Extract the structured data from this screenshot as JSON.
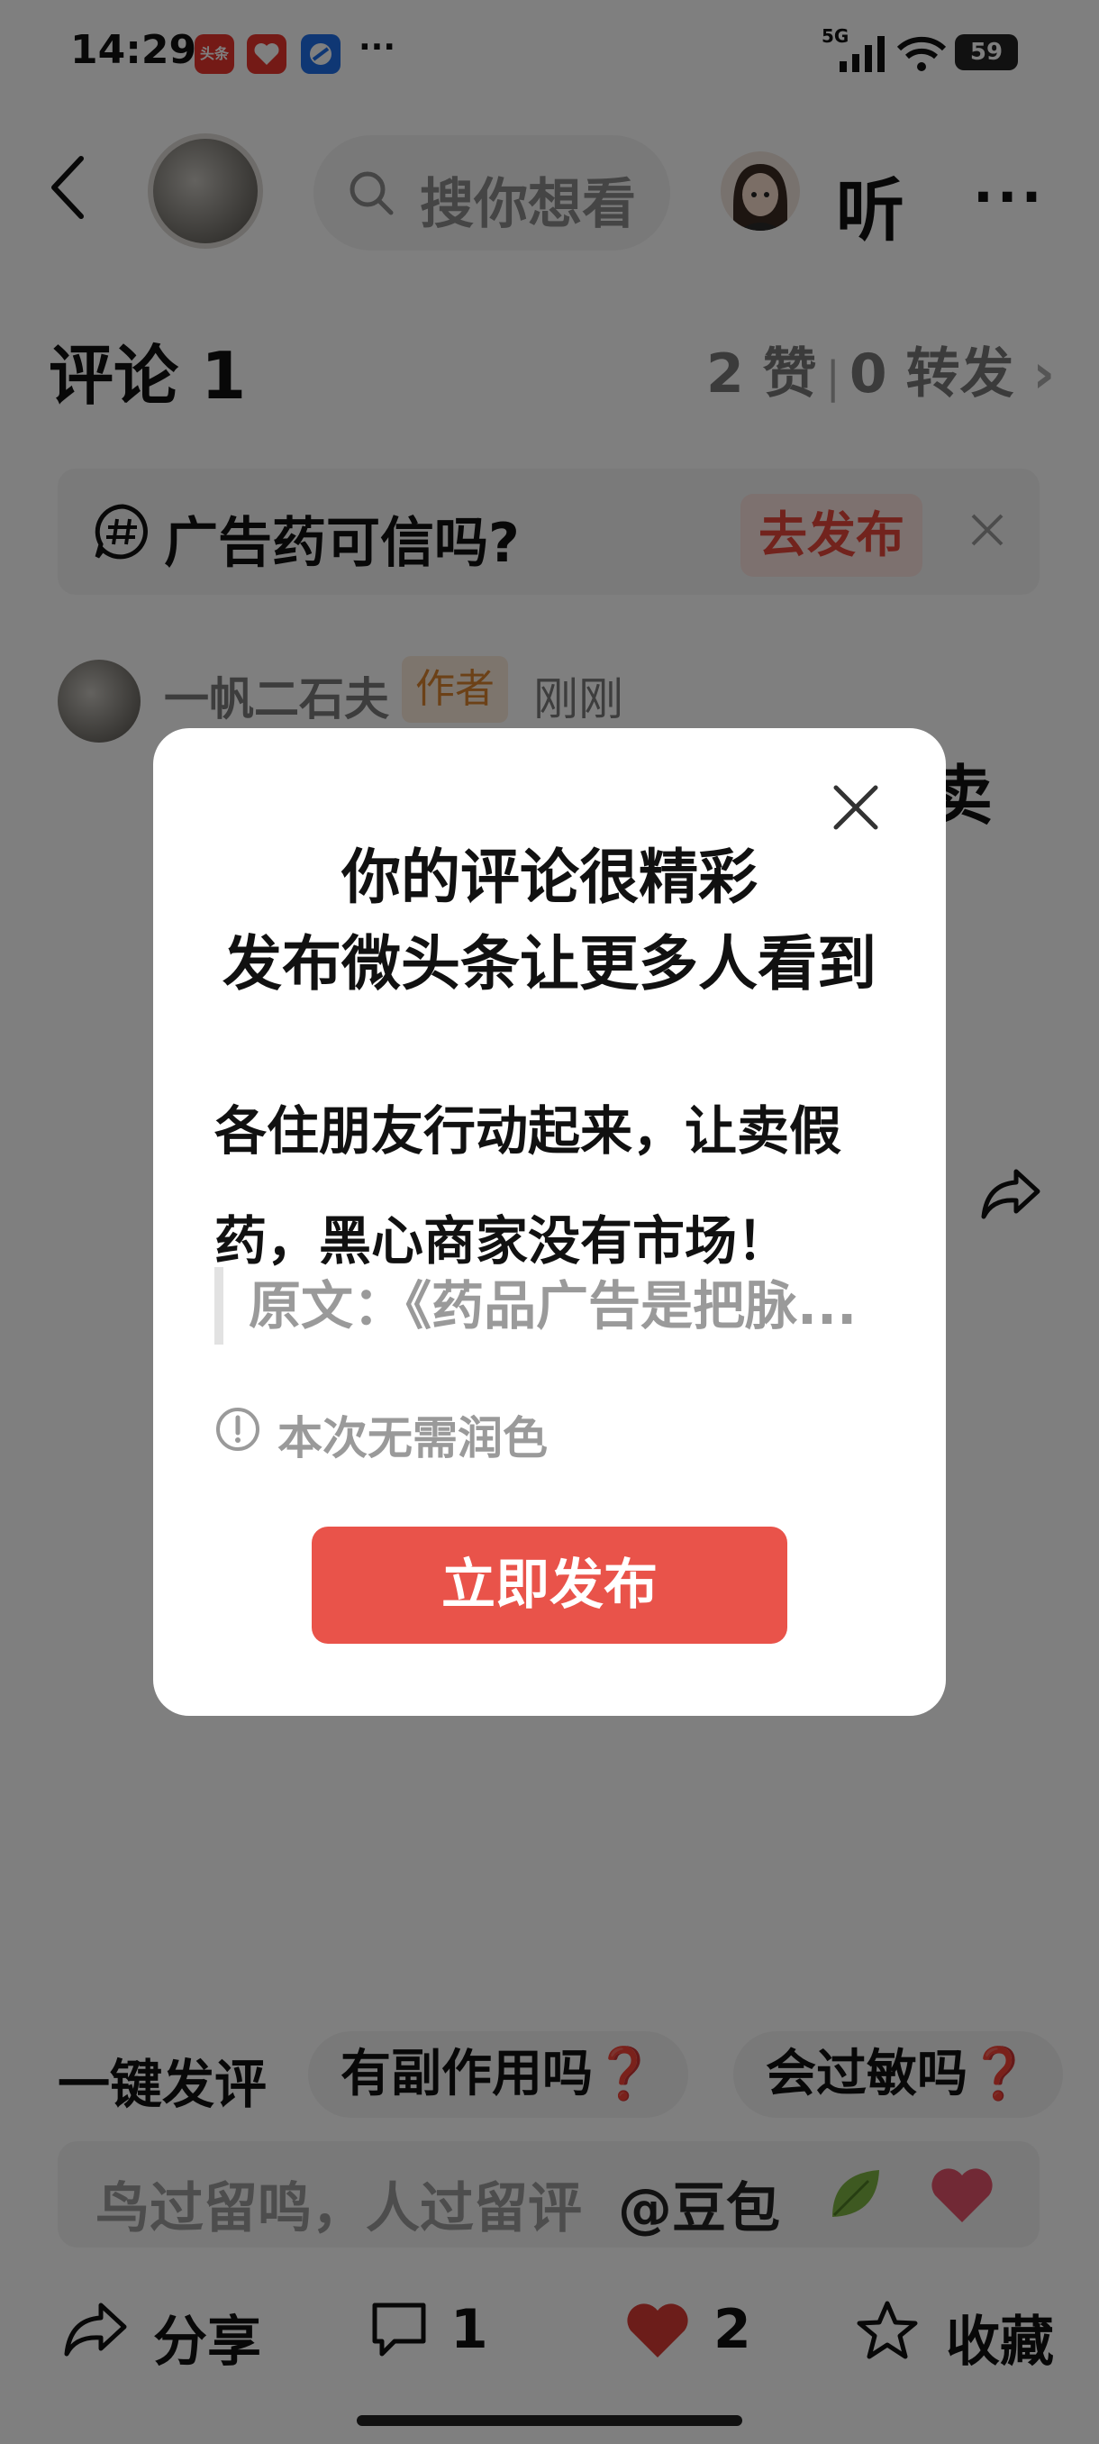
{
  "status_bar": {
    "time": "14:29",
    "toutiao_icon_text": "头条",
    "more": "···",
    "network": "5G",
    "battery": "59"
  },
  "header": {
    "search_placeholder": "搜你想看",
    "listen_label": "听",
    "more_label": "···"
  },
  "comments": {
    "title": "评论 1",
    "likes": "2 赞",
    "reposts": "0 转发",
    "stats_arrow": "›"
  },
  "topic": {
    "text": "广告药可信吗?",
    "publish_label": "去发布"
  },
  "comment": {
    "username": "一帆二石夫",
    "badge": "作者",
    "time": "刚刚",
    "visible_tail": "卖"
  },
  "quick_reply": {
    "label": "一键发评",
    "chip1": "有副作用吗",
    "chip1_mark": "❓",
    "chip2": "会过敏吗",
    "chip2_mark": "❓"
  },
  "input": {
    "placeholder": "鸟过留鸣，人过留评",
    "doubao": "@豆包"
  },
  "actions": {
    "share_label": "分享",
    "comment_count": "1",
    "like_count": "2",
    "favorite_label": "收藏"
  },
  "dialog": {
    "title_line1": "你的评论很精彩",
    "title_line2": "发布微头条让更多人看到",
    "body": "各住朋友行动起来，让卖假药，黑心商家没有市场！",
    "quote": "原文：《药品广告是把脉...",
    "note": "本次无需润色",
    "publish_button": "立即发布"
  },
  "colors": {
    "accent_red": "#e9534a",
    "badge_orange": "#d9822e",
    "like_red": "#d83a35"
  }
}
